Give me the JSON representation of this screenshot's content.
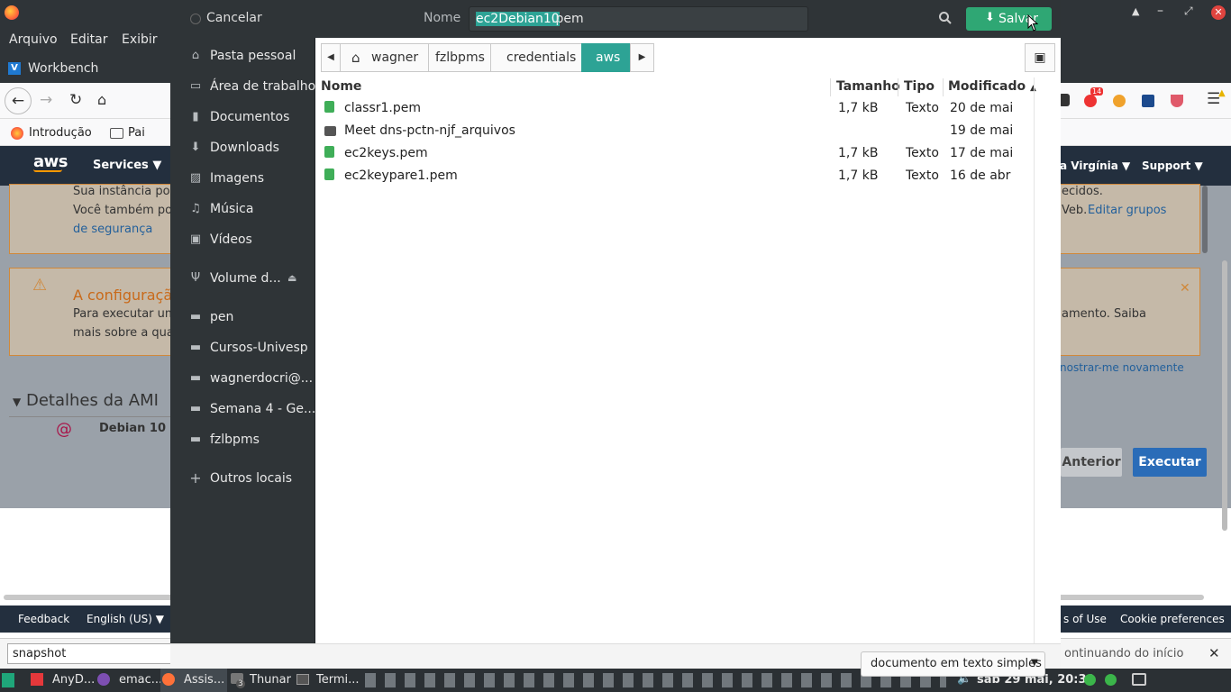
{
  "background": {
    "menu": [
      "Arquivo",
      "Editar",
      "Exibir"
    ],
    "tab_title": "Workbench",
    "bookmarks": [
      "Introdução",
      "Pai"
    ],
    "aws_nav": {
      "services": "Services",
      "region": "a Virgínia",
      "support": "Support"
    },
    "sec_text1": "Sua instância poc",
    "sec_text1_right": "ecidos.",
    "sec_text2": "Você também poc",
    "sec_text2_right": "Veb.",
    "sec_link_edit": "Editar grupos",
    "sec_link_sec": "de segurança",
    "warn_title": "A configuraçã",
    "warn_text1": "Para executar um",
    "warn_text1_right": "amento. Saiba",
    "warn_text2": "mais sobre a qua",
    "dont_show": "nostrar-me novamente",
    "ami_header": "Detalhes da AMI",
    "ami_name": "Debian 10 (",
    "btn_anterior": "Anterior",
    "btn_executar": "Executar",
    "footer": {
      "feedback": "Feedback",
      "language": "English (US)",
      "terms": "s of Use",
      "cookies": "Cookie preferences"
    },
    "find_value": "snapshot",
    "find_status": "ontinuando do início",
    "notification_count": "14"
  },
  "dialog": {
    "cancel": "Cancelar",
    "name_label": "Nome",
    "filename_selected": "ec2Debian10",
    "filename_ext": ".pem",
    "save": "Salvar",
    "sidebar": [
      {
        "label": "Pasta pessoal",
        "icon": "home-icon"
      },
      {
        "label": "Área de trabalho",
        "icon": "desktop-icon"
      },
      {
        "label": "Documentos",
        "icon": "document-icon"
      },
      {
        "label": "Downloads",
        "icon": "download-icon"
      },
      {
        "label": "Imagens",
        "icon": "image-icon"
      },
      {
        "label": "Música",
        "icon": "music-icon"
      },
      {
        "label": "Vídeos",
        "icon": "video-icon"
      },
      {
        "label": "Volume d...",
        "icon": "usb-icon"
      },
      {
        "label": "pen",
        "icon": "folder-icon"
      },
      {
        "label": "Cursos-Univesp",
        "icon": "folder-icon"
      },
      {
        "label": "wagnerdocri@...",
        "icon": "folder-icon"
      },
      {
        "label": "Semana 4 - Ge...",
        "icon": "folder-icon"
      },
      {
        "label": "fzlbpms",
        "icon": "folder-icon"
      },
      {
        "label": "Outros locais",
        "icon": "plus-icon"
      }
    ],
    "breadcrumb": [
      "wagner",
      "fzlbpms",
      "credentials",
      "aws"
    ],
    "columns": {
      "name": "Nome",
      "size": "Tamanho",
      "type": "Tipo",
      "modified": "Modificado"
    },
    "files": [
      {
        "name": "classr1.pem",
        "size": "1,7 kB",
        "type": "Texto",
        "modified": "20 de mai",
        "kind": "file"
      },
      {
        "name": "Meet dns-pctn-njf_arquivos",
        "size": "",
        "type": "",
        "modified": "19 de mai",
        "kind": "folder"
      },
      {
        "name": "ec2keys.pem",
        "size": "1,7 kB",
        "type": "Texto",
        "modified": "17 de mai",
        "kind": "file"
      },
      {
        "name": "ec2keypare1.pem",
        "size": "1,7 kB",
        "type": "Texto",
        "modified": "16 de abr",
        "kind": "file"
      }
    ],
    "filter": "documento em texto simples"
  },
  "taskbar": {
    "items": [
      "AnyD...",
      "emac...",
      "Assis...",
      "Thunar",
      "Termi..."
    ],
    "thunar_badge": "3",
    "clock": "sáb 29 mai, 20:30"
  },
  "colors": {
    "accent": "#2fa774",
    "dark": "#2f3437",
    "aws_nav": "#232f3e",
    "selected_crumb": "#2da395"
  }
}
